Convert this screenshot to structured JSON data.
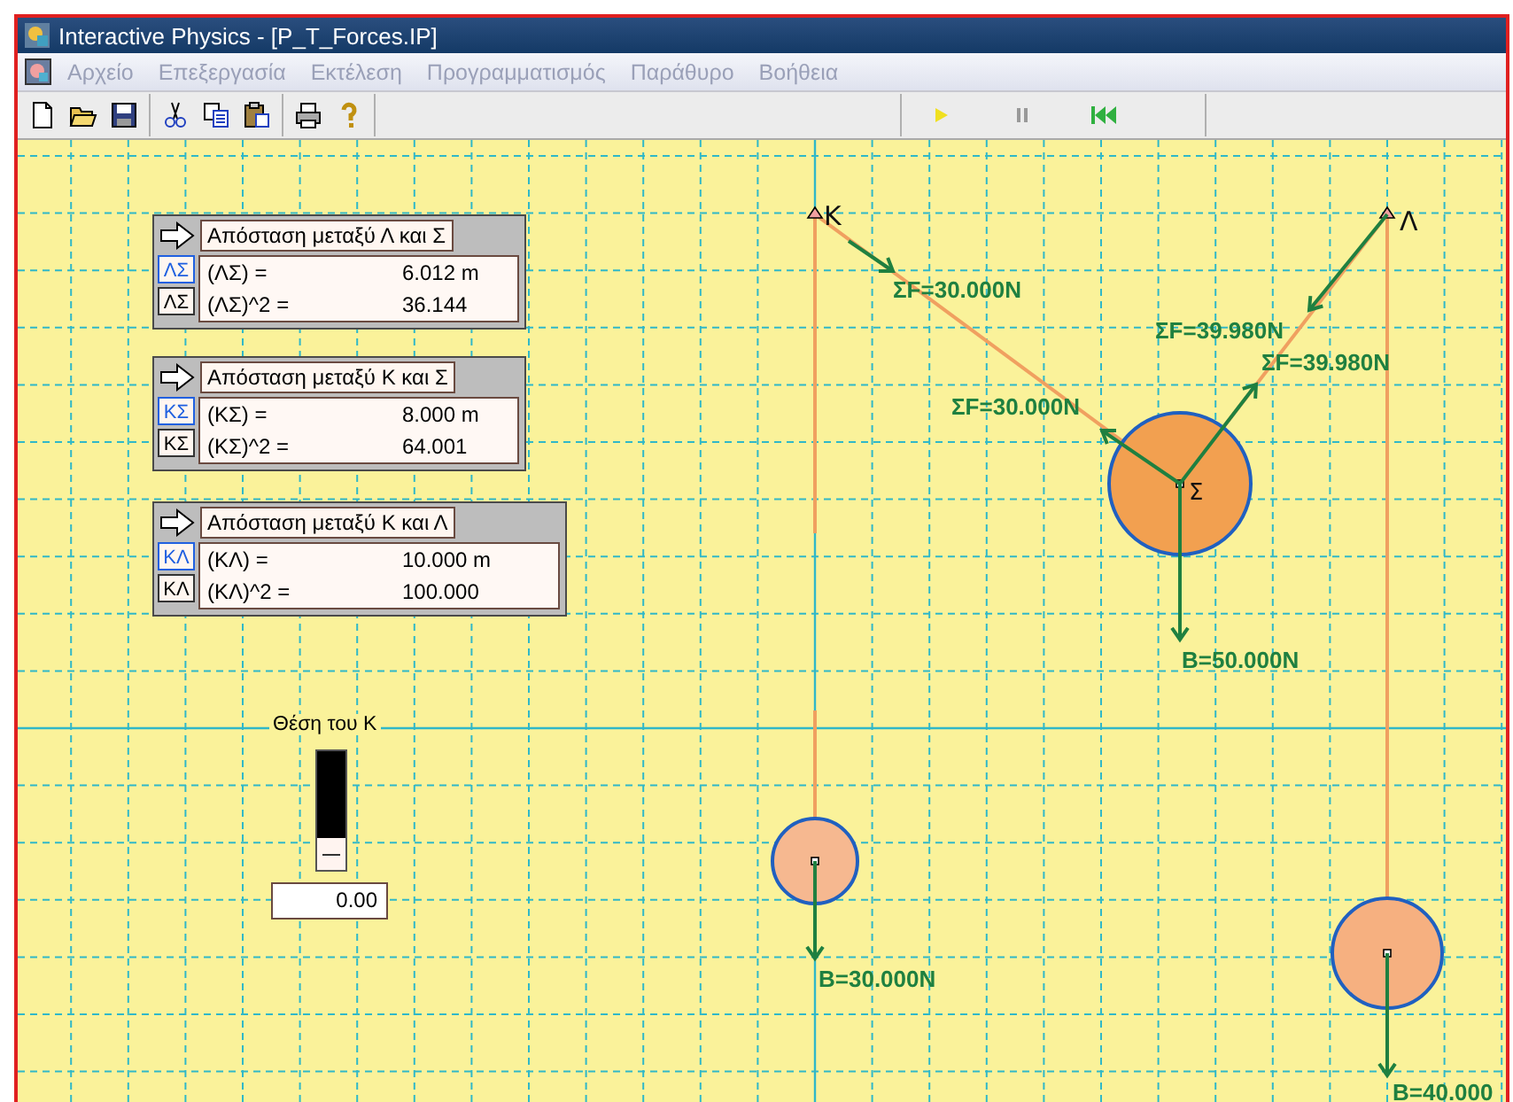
{
  "window": {
    "title": "Interactive Physics - [P_T_Forces.IP]"
  },
  "menu": [
    {
      "label": "Αρχείο",
      "disabled": true
    },
    {
      "label": "Επεξεργασία",
      "disabled": true
    },
    {
      "label": "Εκτέλεση",
      "disabled": true
    },
    {
      "label": "Προγραμματισμός",
      "disabled": true
    },
    {
      "label": "Παράθυρο",
      "disabled": true
    },
    {
      "label": "Βοήθεια",
      "disabled": true
    }
  ],
  "meters": [
    {
      "title": "Απόσταση μεταξύ Λ και Σ",
      "rows": [
        {
          "icon": "ΛΣ",
          "label": "(ΛΣ) =",
          "value": "6.012 m"
        },
        {
          "icon": "ΛΣ",
          "label": "(ΛΣ)^2 =",
          "value": "36.144"
        }
      ]
    },
    {
      "title": "Απόσταση μεταξύ Κ και Σ",
      "rows": [
        {
          "icon": "ΚΣ",
          "label": "(ΚΣ) =",
          "value": "8.000 m"
        },
        {
          "icon": "ΚΣ",
          "label": "(ΚΣ)^2 =",
          "value": "64.001"
        }
      ]
    },
    {
      "title": "Απόσταση μεταξύ Κ και Λ",
      "rows": [
        {
          "icon": "ΚΛ",
          "label": "(ΚΛ) =",
          "value": "10.000 m"
        },
        {
          "icon": "ΚΛ",
          "label": "(ΚΛ)^2 =",
          "value": "100.000"
        }
      ]
    }
  ],
  "slider": {
    "label": "Θέση του Κ",
    "value": "0.00"
  },
  "anchors": [
    {
      "label": "K"
    },
    {
      "label": "Λ"
    }
  ],
  "bodies": [
    {
      "label": "Σ"
    }
  ],
  "force_labels": [
    "ΣF=30.000N",
    "ΣF=30.000N",
    "ΣF=39.980N",
    "ΣF=39.980N",
    "B=50.000N",
    "B=30.000N",
    "B=40.000"
  ]
}
